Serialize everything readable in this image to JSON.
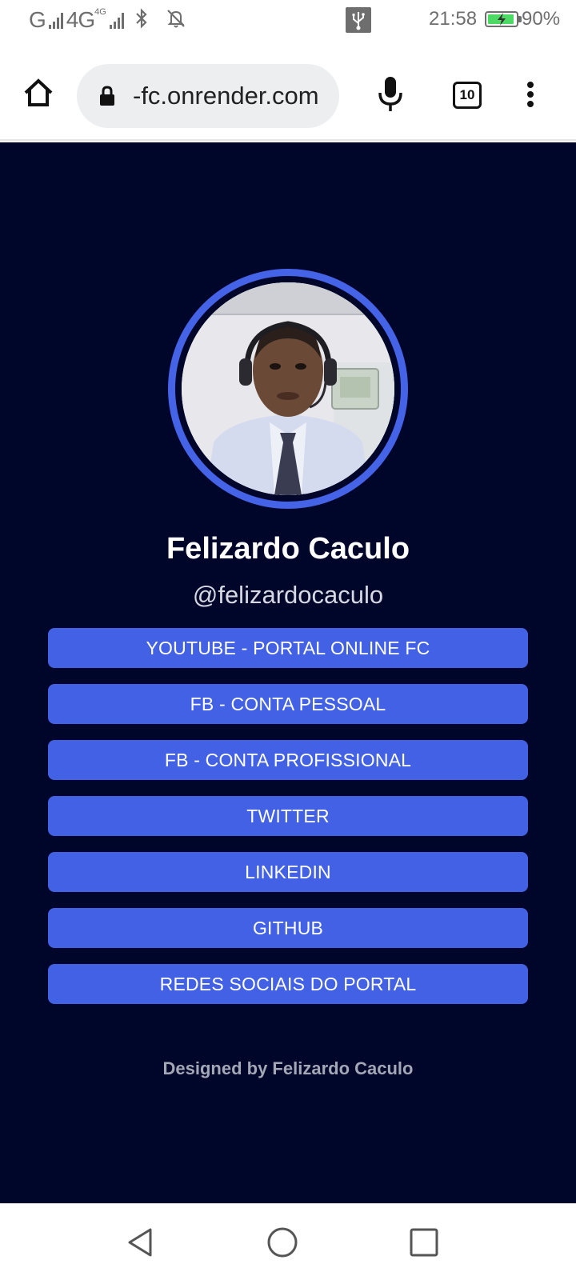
{
  "status_bar": {
    "network_left": "G",
    "network_type": "4G",
    "network_sup": "4G",
    "icons": [
      "signal-icon",
      "bluetooth-icon",
      "bell-off-icon",
      "usb-icon",
      "battery-charging-icon"
    ],
    "time": "21:58",
    "battery_percent": "90%",
    "battery_level": 0.9,
    "battery_color": "#4cd964"
  },
  "browser": {
    "url": "-fc.onrender.com",
    "tab_count": "10",
    "icons": [
      "home-icon",
      "lock-icon",
      "mic-icon",
      "tabs-icon",
      "more-vert-icon"
    ]
  },
  "profile": {
    "name": "Felizardo Caculo",
    "handle": "@felizardocaculo"
  },
  "links": [
    {
      "label": "YOUTUBE - PORTAL ONLINE FC"
    },
    {
      "label": "FB - CONTA PESSOAL"
    },
    {
      "label": "FB - CONTA PROFISSIONAL"
    },
    {
      "label": "TWITTER"
    },
    {
      "label": "LINKEDIN"
    },
    {
      "label": "GITHUB"
    },
    {
      "label": "REDES SOCIAIS DO PORTAL"
    }
  ],
  "footer": {
    "text": "Designed by Felizardo Caculo"
  },
  "nav_bar": {
    "icons": [
      "back-icon",
      "home-circle-icon",
      "recents-icon"
    ]
  },
  "colors": {
    "page_background": "#00052a",
    "accent": "#4361e5",
    "ring": "#4563e6",
    "text_primary": "#ffffff",
    "text_secondary": "#d6d8e3",
    "footer_text": "#a4a7b5"
  }
}
